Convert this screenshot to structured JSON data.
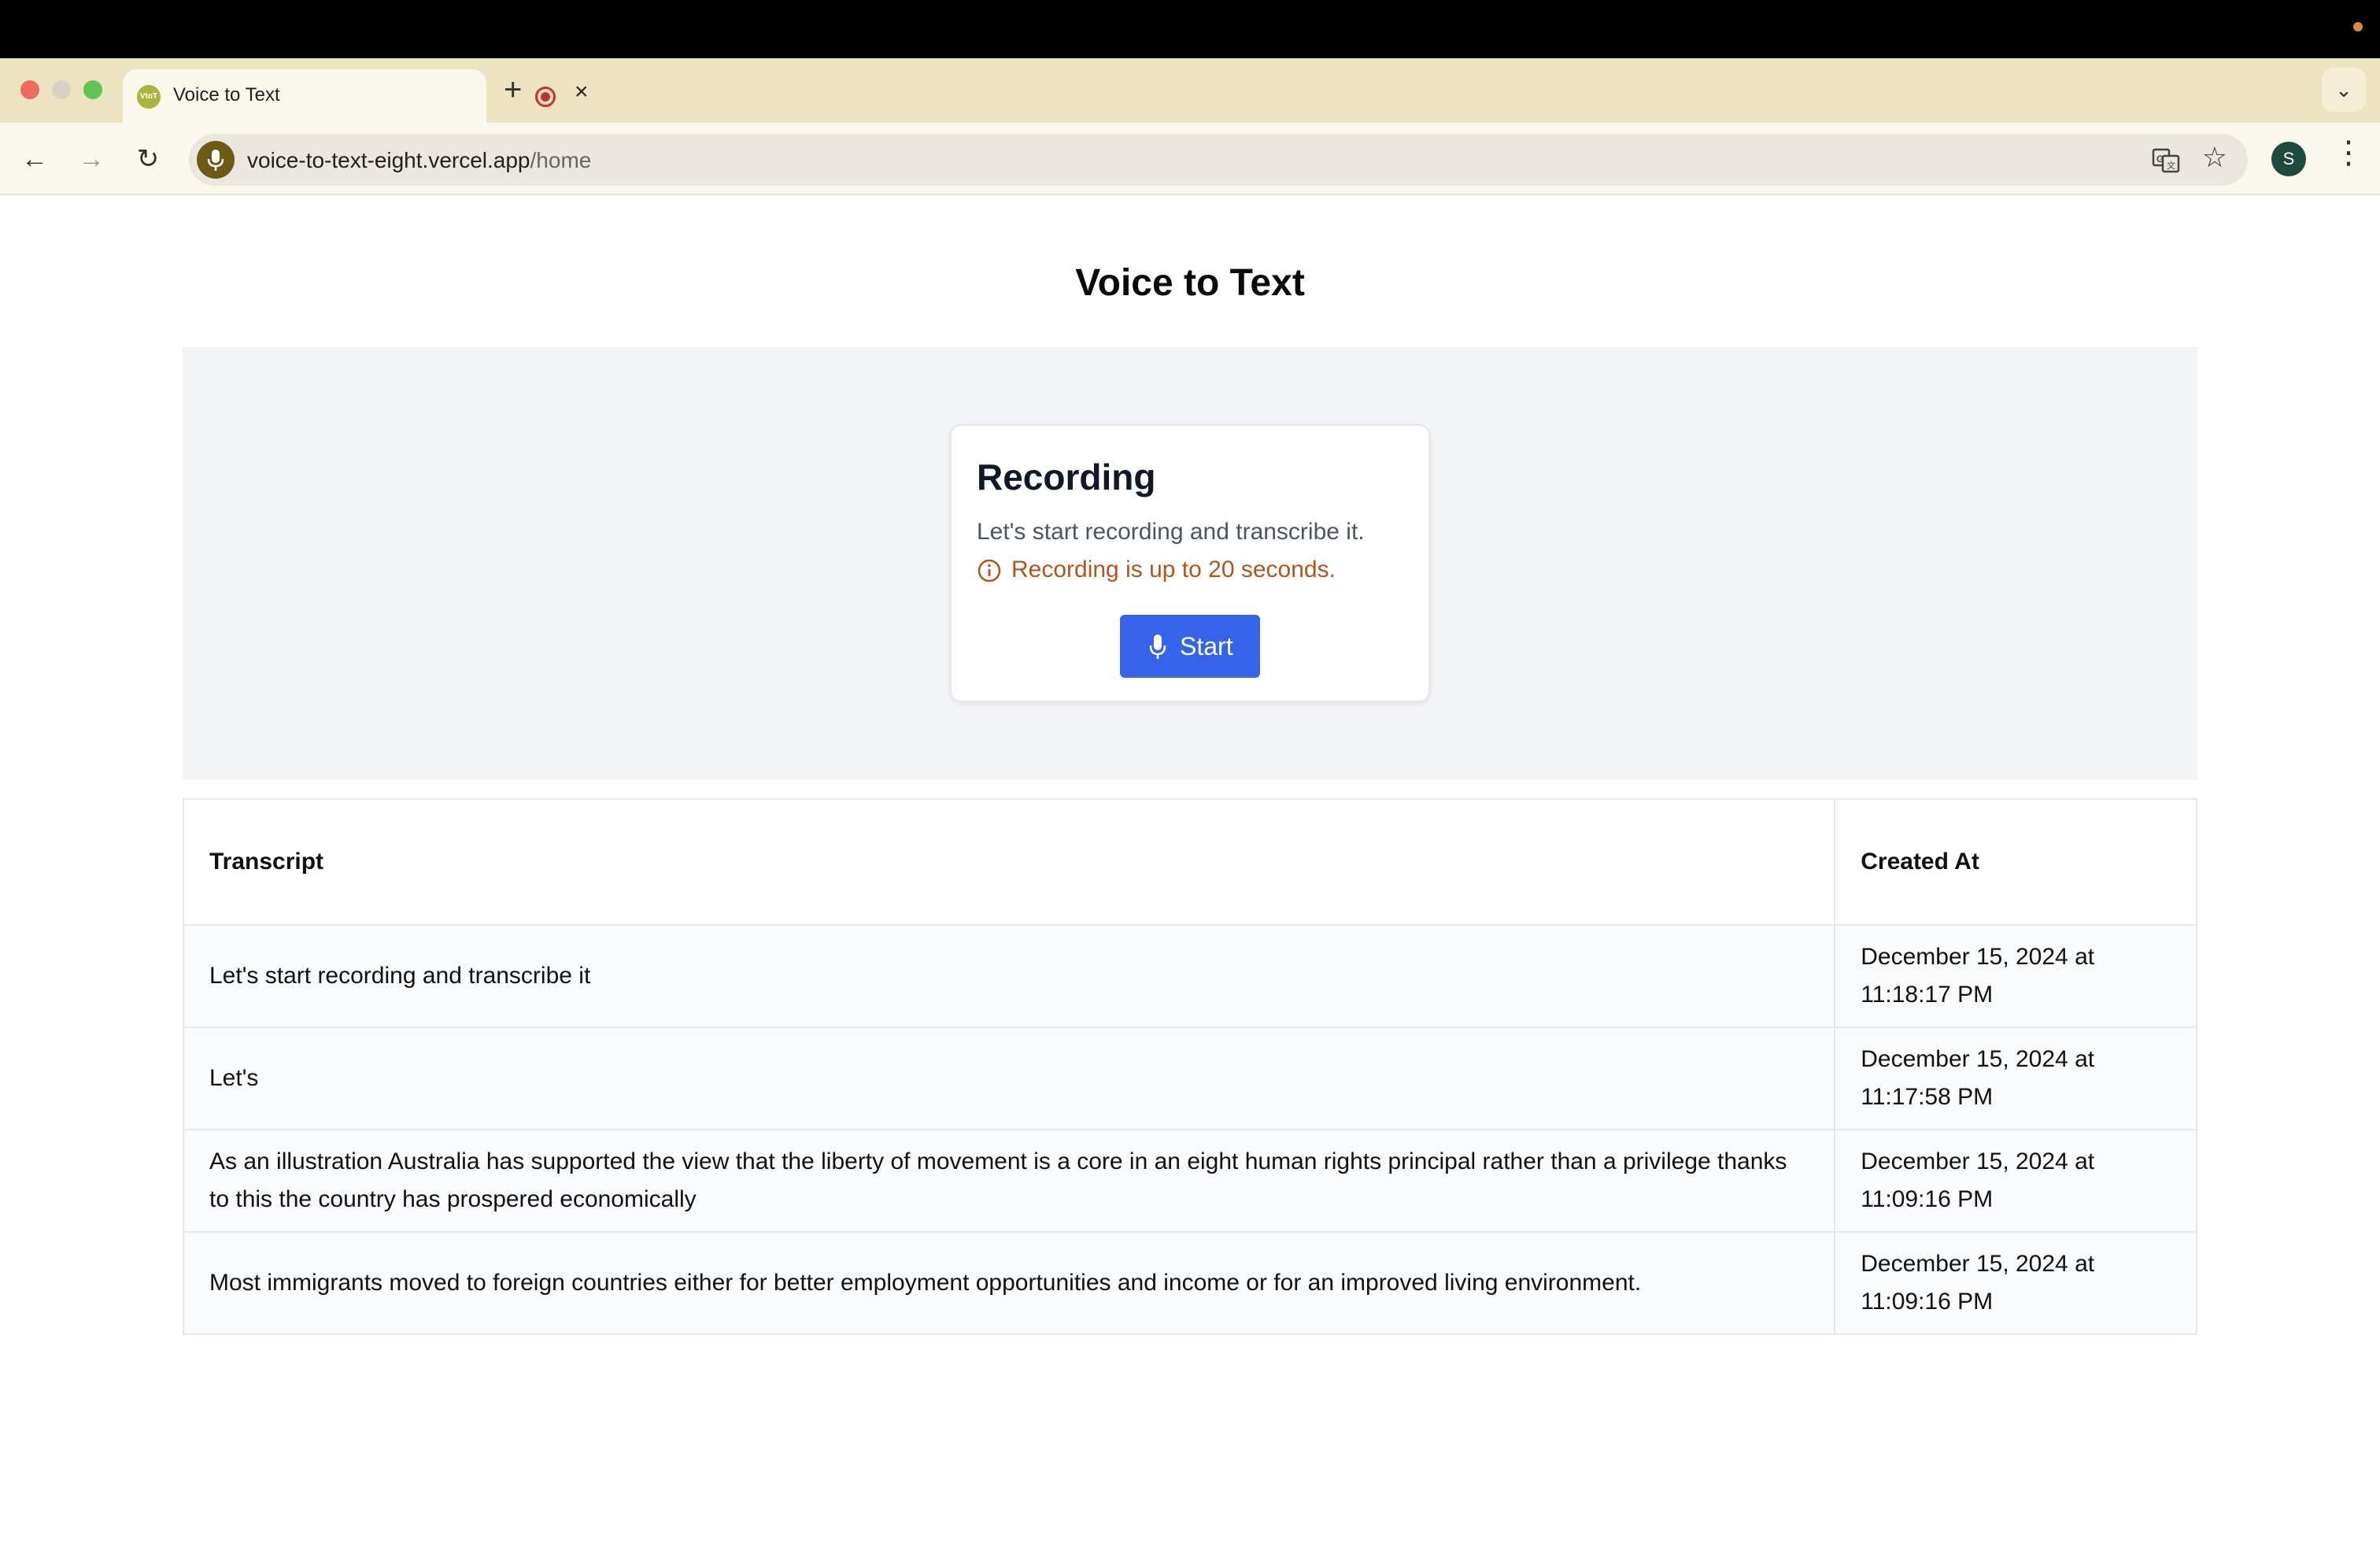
{
  "browser": {
    "tab": {
      "title": "Voice to Text",
      "favicon_text": "VtoT"
    },
    "new_tab_icon": "plus-icon",
    "address": {
      "host": "voice-to-text-eight.vercel.app",
      "path": "/home"
    },
    "profile_initial": "S"
  },
  "page": {
    "title": "Voice to Text"
  },
  "recording_card": {
    "title": "Recording",
    "description": "Let's start recording and transcribe it.",
    "note": "Recording is up to 20 seconds.",
    "start_label": "Start"
  },
  "table": {
    "headers": {
      "transcript": "Transcript",
      "created_at": "Created At"
    },
    "rows": [
      {
        "transcript": "Let's start recording and transcribe it",
        "created_date": "December 15, 2024 at",
        "created_time": "11:18:17 PM"
      },
      {
        "transcript": "Let's",
        "created_date": "December 15, 2024 at",
        "created_time": "11:17:58 PM"
      },
      {
        "transcript": "As an illustration Australia has supported the view that the liberty of movement is a core in an eight human rights principal rather than a privilege thanks to this the country has prospered economically",
        "created_date": "December 15, 2024 at",
        "created_time": "11:09:16 PM"
      },
      {
        "transcript": "Most immigrants moved to foreign countries either for better employment opportunities and income or for an improved living environment.",
        "created_date": "December 15, 2024 at",
        "created_time": "11:09:16 PM"
      }
    ]
  },
  "colors": {
    "primary_button": "#3563e9",
    "warning_text": "#b4531c",
    "panel_bg": "#f3f4f6"
  }
}
